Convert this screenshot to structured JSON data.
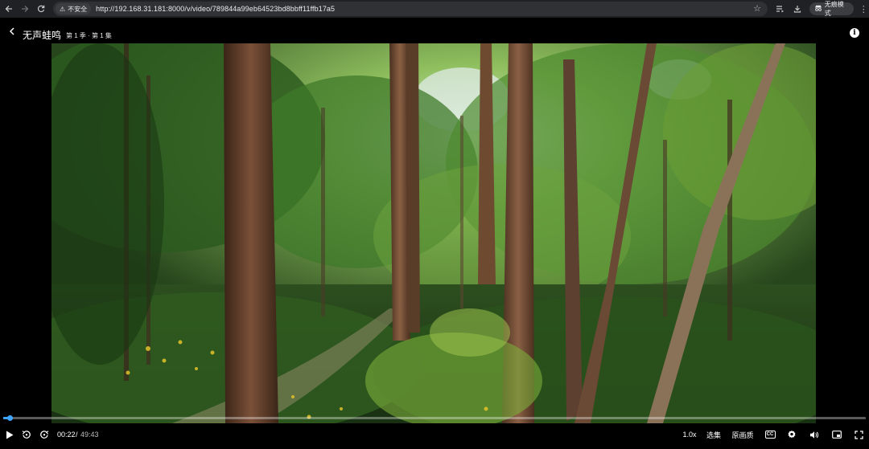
{
  "browser": {
    "security_label": "不安全",
    "url": "http://192.168.31.181:8000/v/video/789844a99eb64523bd8bbff11ffb17a5",
    "incognito_label": "无痕模式"
  },
  "player": {
    "title": "无声蛙鸣",
    "episode": "第 1 季 · 第 1 集",
    "time_current": "00:22",
    "time_separator": "/",
    "time_total": "49:43",
    "progress_fraction": 0.0074,
    "speed_label": "1.0x",
    "episodes_label": "选集",
    "quality_label": "原画质",
    "cc_label": "CC",
    "accent_color": "#3ea6ff"
  },
  "icons": {
    "back": "back-arrow-icon",
    "forward": "forward-arrow-icon",
    "reload": "reload-icon",
    "warning": "warning-icon",
    "star": "star-icon",
    "playlist": "playlist-icon",
    "download": "download-icon",
    "incognito": "incognito-icon",
    "menu": "kebab-menu-icon",
    "info": "info-icon",
    "play": "play-icon",
    "rewind": "rewind-10-icon",
    "skip_forward": "forward-10-icon",
    "settings": "gear-icon",
    "volume": "volume-icon",
    "pip": "picture-in-picture-icon",
    "fullscreen": "fullscreen-icon"
  }
}
